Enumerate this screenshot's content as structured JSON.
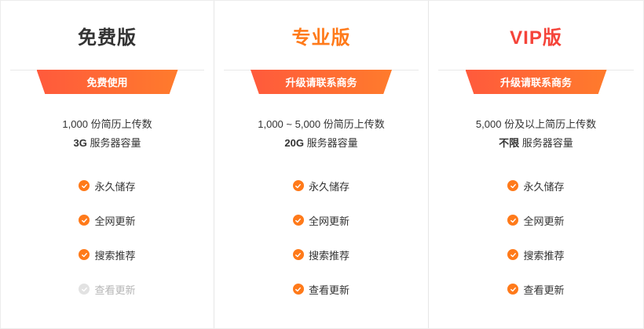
{
  "plans": [
    {
      "title": "免费版",
      "button_label": "免费使用",
      "quota_line1": "1,000 份简历上传数",
      "quota_line2_strong": "3G",
      "quota_line2_text": " 服务器容量",
      "features": [
        {
          "label": "永久储存",
          "enabled": true
        },
        {
          "label": "全网更新",
          "enabled": true
        },
        {
          "label": "搜索推荐",
          "enabled": true
        },
        {
          "label": "查看更新",
          "enabled": false
        }
      ]
    },
    {
      "title": "专业版",
      "button_label": "升级请联系商务",
      "quota_line1": "1,000 ~ 5,000 份简历上传数",
      "quota_line2_strong": "20G",
      "quota_line2_text": " 服务器容量",
      "features": [
        {
          "label": "永久储存",
          "enabled": true
        },
        {
          "label": "全网更新",
          "enabled": true
        },
        {
          "label": "搜索推荐",
          "enabled": true
        },
        {
          "label": "查看更新",
          "enabled": true
        }
      ]
    },
    {
      "title": "VIP版",
      "button_label": "升级请联系商务",
      "quota_line1": "5,000 份及以上简历上传数",
      "quota_line2_strong": "不限",
      "quota_line2_text": " 服务器容量",
      "features": [
        {
          "label": "永久储存",
          "enabled": true
        },
        {
          "label": "全网更新",
          "enabled": true
        },
        {
          "label": "搜索推荐",
          "enabled": true
        },
        {
          "label": "查看更新",
          "enabled": true
        }
      ]
    }
  ],
  "colors": {
    "accent_orange": "#ff7a1a",
    "accent_red": "#f5443a",
    "button_gradient_start": "#ff5a3c",
    "button_gradient_end": "#ff7b2c",
    "disabled_gray": "#b5b5b5"
  },
  "icons": {
    "enabled_feature": "check-circle-icon",
    "disabled_feature": "check-circle-disabled-icon"
  }
}
